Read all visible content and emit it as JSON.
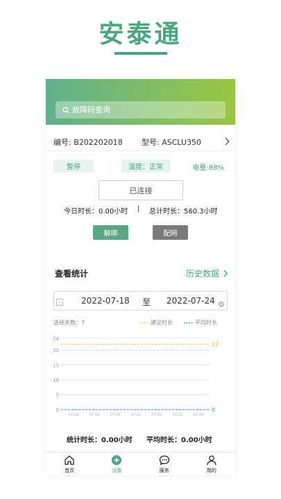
{
  "app_title": "安泰通",
  "search": {
    "placeholder": "故障码查询"
  },
  "device": {
    "number_label": "编号:",
    "number": "B202202018",
    "model_label": "型号:",
    "model": "ASCLU350",
    "status": "暂停",
    "temperature": "温度：正常",
    "battery": "电量:88%",
    "connection": "已连接",
    "today_time": "今日时长：0.00小时",
    "separator": "|",
    "total_time": "总计时长：560.3小时",
    "unbind_label": "解绑",
    "network_label": "配网"
  },
  "stats": {
    "title": "查看统计",
    "history_link": "历史数据",
    "start_date": "2022-07-18",
    "to_label": "至",
    "end_date": "2022-07-24",
    "days_selected": "选择天数：7",
    "legend_suggest": "建议时长",
    "legend_average": "平均时长",
    "stat_time": "统计时长：0.00小时",
    "avg_time": "平均时长：0.00小时"
  },
  "colors": {
    "brand": "#4aa583",
    "suggest_line": "#e3d35a",
    "average_line": "#3a8fc8"
  },
  "chart_data": {
    "type": "line",
    "x": [
      "07.18",
      "07.19",
      "07.20",
      "07.21",
      "07.22",
      "07.23",
      "07.24"
    ],
    "series": [
      {
        "name": "建议时长",
        "values": [
          22,
          22,
          22,
          22,
          22,
          22,
          22
        ],
        "end_label": "22"
      },
      {
        "name": "平均时长",
        "values": [
          0,
          0,
          0,
          0,
          0,
          0,
          0
        ],
        "end_label": "0"
      }
    ],
    "yticks": [
      0,
      5,
      10,
      15,
      20,
      24
    ],
    "ylim": [
      0,
      24
    ],
    "grid": true
  },
  "tabs": [
    {
      "label": "首页",
      "icon": "home-icon"
    },
    {
      "label": "设备",
      "icon": "plus-circle-icon",
      "active": true
    },
    {
      "label": "服务",
      "icon": "chat-icon"
    },
    {
      "label": "我的",
      "icon": "user-icon"
    }
  ]
}
